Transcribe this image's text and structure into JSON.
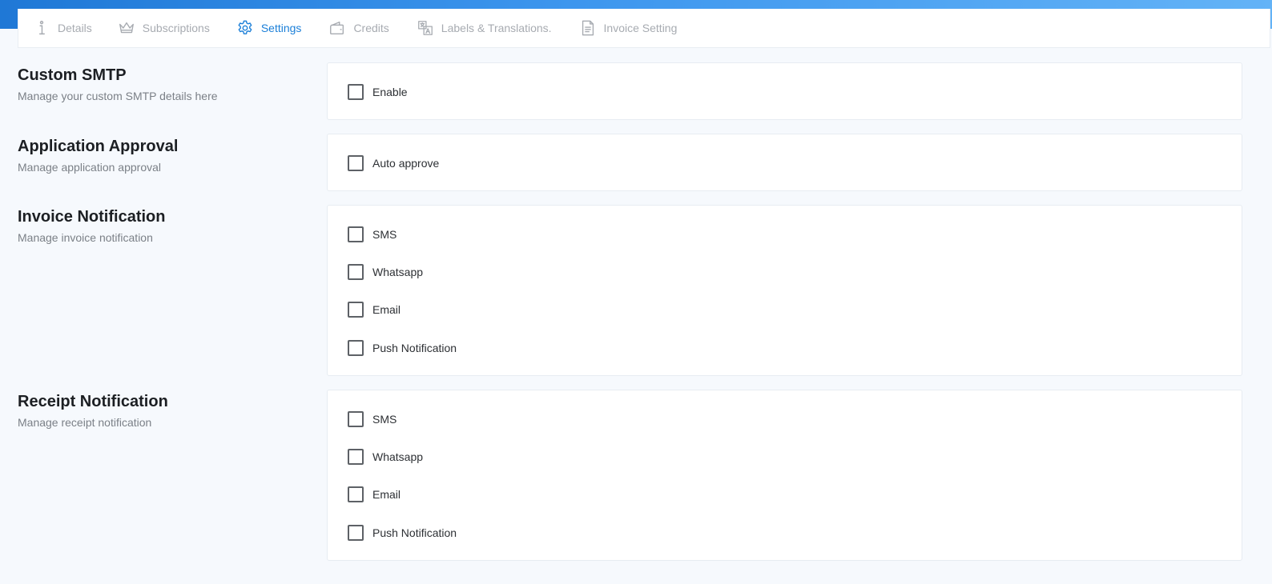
{
  "tabs": [
    {
      "label": "Details",
      "icon": "info-icon",
      "active": false
    },
    {
      "label": "Subscriptions",
      "icon": "crown-icon",
      "active": false
    },
    {
      "label": "Settings",
      "icon": "gear-icon",
      "active": true
    },
    {
      "label": "Credits",
      "icon": "wallet-icon",
      "active": false
    },
    {
      "label": "Labels & Translations.",
      "icon": "translate-icon",
      "active": false
    },
    {
      "label": "Invoice Setting",
      "icon": "document-icon",
      "active": false
    }
  ],
  "sections": {
    "smtp": {
      "title": "Custom SMTP",
      "desc": "Manage your custom SMTP details here",
      "options": [
        {
          "label": "Enable",
          "checked": false
        }
      ]
    },
    "approval": {
      "title": "Application Approval",
      "desc": "Manage application approval",
      "options": [
        {
          "label": "Auto approve",
          "checked": false
        }
      ]
    },
    "invoice": {
      "title": "Invoice Notification",
      "desc": "Manage invoice notification",
      "options": [
        {
          "label": "SMS",
          "checked": false
        },
        {
          "label": "Whatsapp",
          "checked": false
        },
        {
          "label": "Email",
          "checked": false
        },
        {
          "label": "Push Notification",
          "checked": false
        }
      ]
    },
    "receipt": {
      "title": "Receipt Notification",
      "desc": "Manage receipt notification",
      "options": [
        {
          "label": "SMS",
          "checked": false
        },
        {
          "label": "Whatsapp",
          "checked": false
        },
        {
          "label": "Email",
          "checked": false
        },
        {
          "label": "Push Notification",
          "checked": false
        }
      ]
    }
  },
  "colors": {
    "accent": "#1b7fd8",
    "inactive_tab": "#a7abb1",
    "background": "#f6f9fd"
  }
}
